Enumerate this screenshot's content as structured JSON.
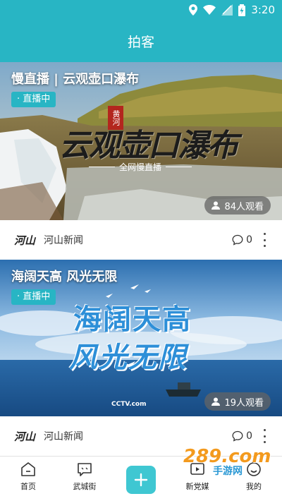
{
  "status": {
    "time": "3:20"
  },
  "header": {
    "title": "拍客"
  },
  "cards": [
    {
      "title": "慢直播 | 云观壶口瀑布",
      "badge": "· 直播中",
      "image_text": "云观壶口瀑布",
      "image_subtext": "全网慢直播",
      "image_seal": "黄河",
      "viewers": "84人观看",
      "source_logo": "河山",
      "source": "河山新闻",
      "comments": "0"
    },
    {
      "title": "海阔天高  风光无限",
      "badge": "· 直播中",
      "image_text_1": "海阔天高",
      "image_text_2": "风光无限",
      "image_logo": "CCTV.com",
      "viewers": "19人观看",
      "source_logo": "河山",
      "source": "河山新闻",
      "comments": "0"
    }
  ],
  "tabbar": {
    "items": [
      {
        "label": "首页",
        "icon": "home-icon"
      },
      {
        "label": "武城街",
        "icon": "chat-icon"
      },
      {
        "label": "",
        "icon": "plus-icon"
      },
      {
        "label": "新党媒",
        "icon": "media-icon"
      },
      {
        "label": "我的",
        "icon": "profile-icon"
      }
    ]
  },
  "watermark": {
    "main": "289.com",
    "sub": "手游网"
  },
  "colors": {
    "accent": "#28b5c4"
  }
}
